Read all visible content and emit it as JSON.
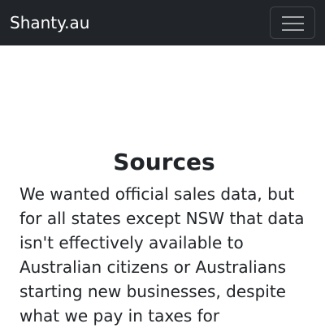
{
  "navbar": {
    "brand": "Shanty.au",
    "toggler_icon": "hamburger-menu-icon",
    "background_color": "#212529"
  },
  "main": {
    "title": "Sources",
    "paragraph": "We wanted official sales data, but for all states except NSW that data isn't effectively available to Australian citizens or Australians starting new businesses, despite what we pay in taxes for"
  }
}
